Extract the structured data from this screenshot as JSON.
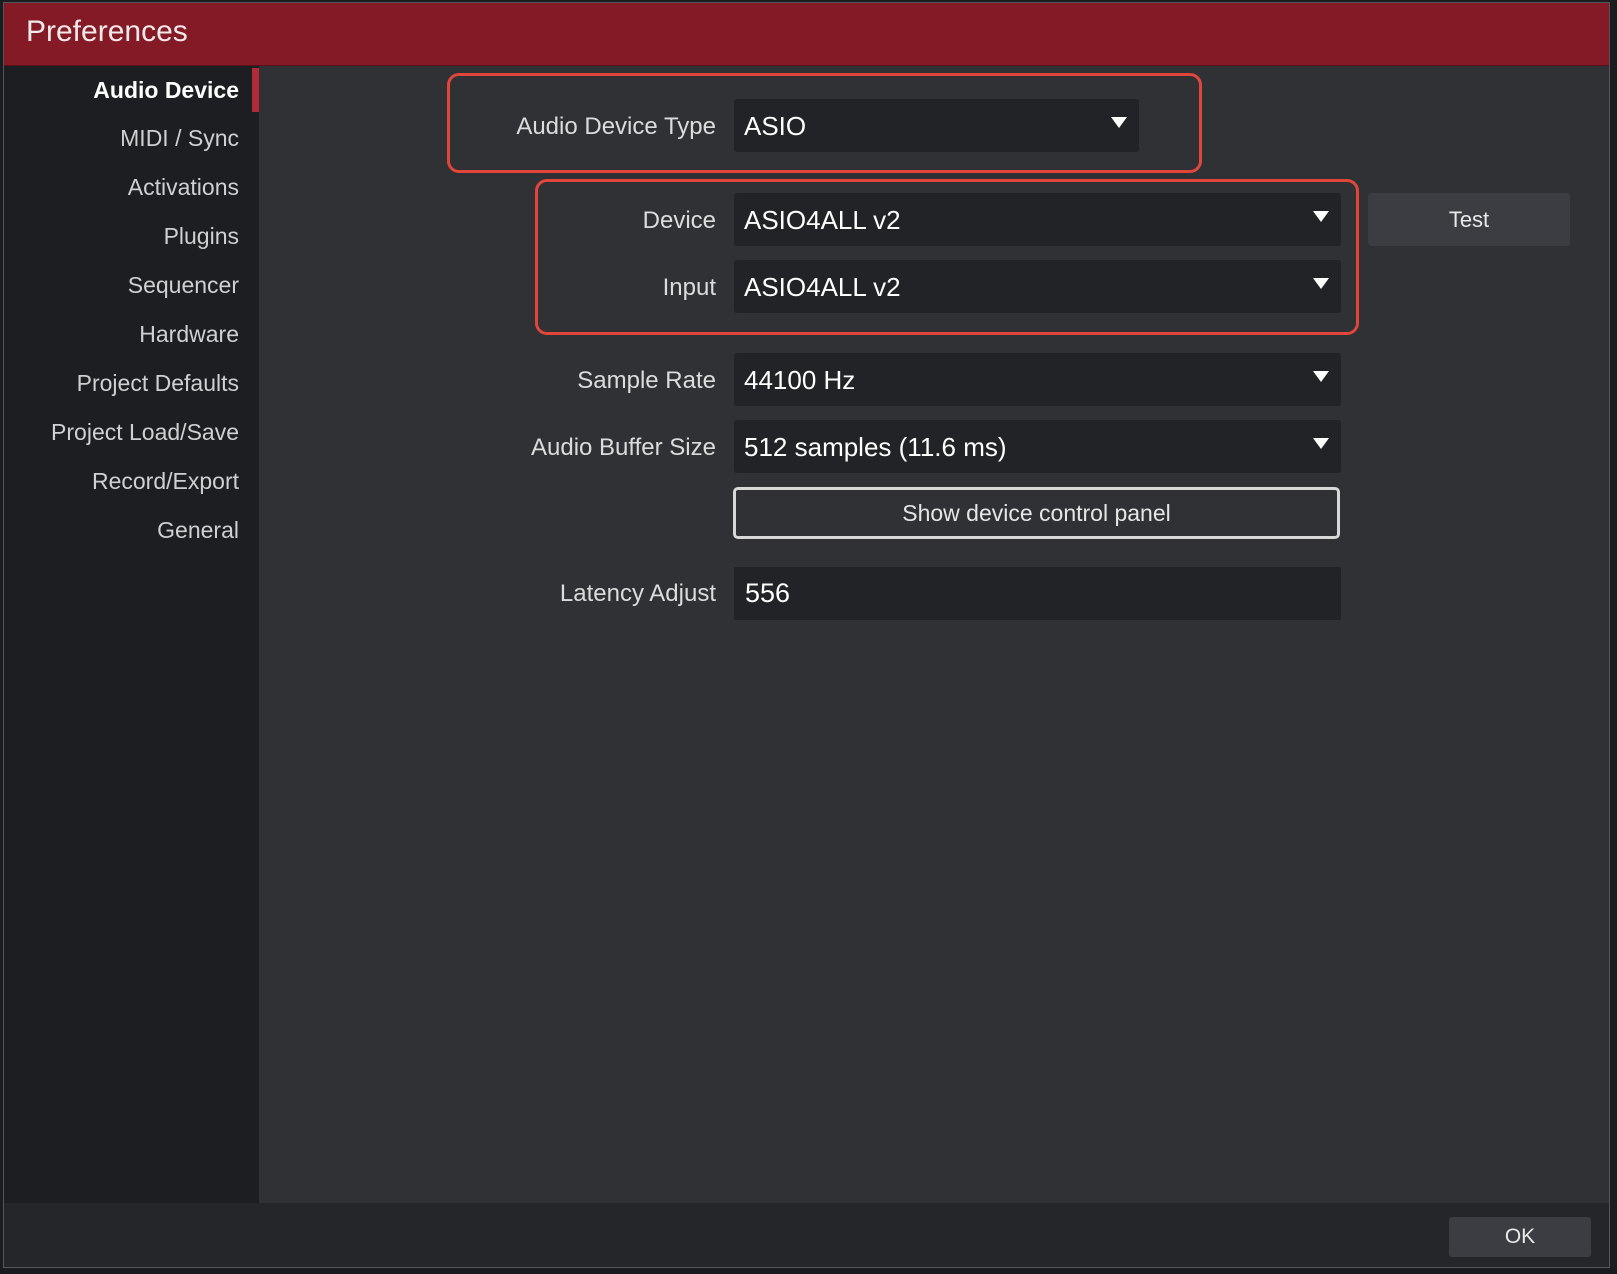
{
  "window": {
    "title": "Preferences"
  },
  "sidebar": {
    "items": [
      {
        "label": "Audio Device"
      },
      {
        "label": "MIDI / Sync"
      },
      {
        "label": "Activations"
      },
      {
        "label": "Plugins"
      },
      {
        "label": "Sequencer"
      },
      {
        "label": "Hardware"
      },
      {
        "label": "Project Defaults"
      },
      {
        "label": "Project Load/Save"
      },
      {
        "label": "Record/Export"
      },
      {
        "label": "General"
      }
    ],
    "selected": "Audio Device"
  },
  "audio_device": {
    "type": {
      "label": "Audio Device Type",
      "value": "ASIO"
    },
    "device": {
      "label": "Device",
      "value": "ASIO4ALL v2"
    },
    "input": {
      "label": "Input",
      "value": "ASIO4ALL v2"
    },
    "test_label": "Test",
    "sample_rate": {
      "label": "Sample Rate",
      "value": "44100 Hz"
    },
    "buffer_size": {
      "label": "Audio Buffer Size",
      "value": "512 samples (11.6 ms)"
    },
    "control_panel_label": "Show device control panel",
    "latency": {
      "label": "Latency Adjust",
      "value": "556"
    }
  },
  "footer": {
    "ok_label": "OK"
  },
  "colors": {
    "title_bar": "#851a27",
    "highlight": "#e0463a",
    "active_indicator": "#b02a37"
  }
}
